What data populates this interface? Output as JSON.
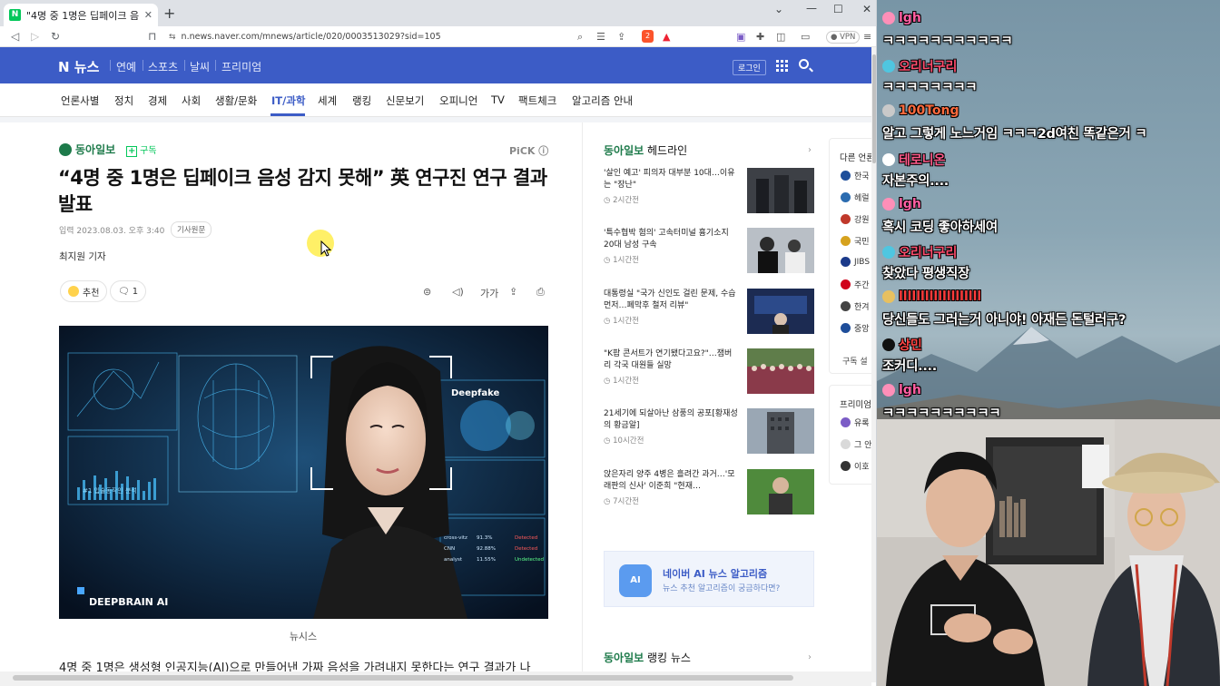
{
  "browser": {
    "tab_title": "\"4명 중 1명은 딥페이크 음성 감지",
    "tab_close": "✕",
    "new_tab": "+",
    "url": "n.news.naver.com/mnews/article/020/0003513029?sid=105",
    "vpn": "● VPN",
    "brave_badge": "2"
  },
  "naver": {
    "logo": "N 뉴스",
    "menu": [
      "연예",
      "스포츠",
      "날씨",
      "프리미엄"
    ],
    "login": "로그인",
    "categories": [
      "언론사별",
      "정치",
      "경제",
      "사회",
      "생활/문화",
      "IT/과학",
      "세계",
      "랭킹",
      "신문보기",
      "오피니언",
      "TV",
      "팩트체크",
      "알고리즘 안내"
    ],
    "active_category": "IT/과학"
  },
  "article": {
    "press": "동아일보",
    "subscribe": "구독",
    "pick": "PiCK ⓘ",
    "headline": "“4명 중 1명은 딥페이크 음성 감지 못해” 英 연구진 연구 결과 발표",
    "date": "입력 2023.08.03. 오후 3:40",
    "original_btn": "기사원문",
    "reporter": "최지원 기자",
    "recommend": "추천",
    "comments": "1",
    "tool_font": "가가",
    "photo": {
      "brand": "DEEPBRAIN AI",
      "panel_label": "Deepfake",
      "panel_small": "#1 입술동작인 분석",
      "stats": [
        {
          "label": "cross-vitz",
          "value": "91.3%",
          "status": "Detected"
        },
        {
          "label": "CNN",
          "value": "92.88%",
          "status": "Detected"
        },
        {
          "label": "analyst",
          "value": "11.55%",
          "status": "Undetected"
        }
      ]
    },
    "caption": "뉴시스",
    "body_first": "4명 중 1명은 생성형 인공지능(AI)으로 만들어낸 가짜 음성을 가려내지 못한다는 연구 결과가 나"
  },
  "headlines": {
    "press": "동아일보",
    "label": "헤드라인",
    "items": [
      {
        "title": "'살인 예고' 피의자 대부분 10대…이유는 \"장난\"",
        "time": "2시간전"
      },
      {
        "title": "'특수협박 혐의' 고속터미널 흉기소지 20대 남성 구속",
        "time": "1시간전"
      },
      {
        "title": "대통령실 \"국가 신인도 걸린 문제, 수습 먼저…폐막후 철저 리뷰\"",
        "time": "1시간전"
      },
      {
        "title": "\"K팝 콘서트가 연기됐다고요?\"…잼버리 각국 대원들 실망",
        "time": "1시간전"
      },
      {
        "title": "21세기에 되살아난 삼풍의 공포[황재성의 황금알]",
        "time": "10시간전"
      },
      {
        "title": "앉은자리 양주 4병은 흘려간 과거…'모래판의 신사' 이준희 \"현재…",
        "time": "7시간전"
      }
    ]
  },
  "algorithm": {
    "icon": "AI",
    "title": "네이버 AI 뉴스 알고리즘",
    "sub": "뉴스 추천 알고리즘이 궁금하다면?"
  },
  "ranking": {
    "press": "동아일보",
    "label": "랭킹 뉴스"
  },
  "side_panel": {
    "title": "다른 언론",
    "items": [
      "한국",
      "헤럴",
      "강원",
      "국민",
      "JIBS",
      "주간",
      "한겨",
      "중앙"
    ],
    "item_colors": [
      "#1e4e9a",
      "#2b6cb0",
      "#c0392b",
      "#d6a21e",
      "#1b3a8a",
      "#d0021b",
      "#444444",
      "#1e4e9a"
    ],
    "button": "구독 설",
    "premium_title": "프리미엄",
    "premium_items": [
      "유록",
      "그 안",
      "이호"
    ]
  },
  "chat": [
    {
      "user": "lgh",
      "color": "#ff5fa2",
      "message": "ㅋㅋㅋㅋㅋㅋㅋㅋㅋㅋㅋ"
    },
    {
      "user": "오리너구리",
      "color": "#ff4d6d",
      "message": "ㅋㅋㅋㅋㅋㅋㅋㅋ"
    },
    {
      "user": "100Tong",
      "color": "#ff6a3d",
      "message": "알고 그렇게 노느거임 ㅋㅋㅋ2d여친 똑같은거 ㅋ"
    },
    {
      "user": "테로니온",
      "color": "#ff5a8a",
      "message": "자본주의...."
    },
    {
      "user": "lgh",
      "color": "#ff5fa2",
      "message": "혹시 코딩 좋아하세여"
    },
    {
      "user": "오리너구리",
      "color": "#ff4d6d",
      "message": "찾았다 평생직장"
    },
    {
      "user": "lllllllllllllllllll",
      "color": "#ff3b3b",
      "message": "당신들도 그러는거 아니야! 아재든 돈털러구?"
    },
    {
      "user": "상민",
      "color": "#ff4444",
      "message": "조커디...."
    },
    {
      "user": "lgh",
      "color": "#ff5fa2",
      "message": "ㅋㅋㅋㅋㅋㅋㅋㅋㅋㅋ"
    }
  ]
}
